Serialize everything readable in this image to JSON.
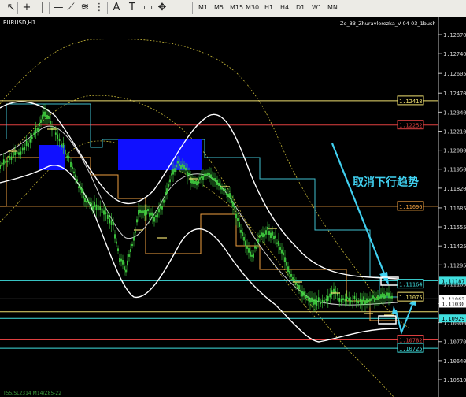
{
  "toolbar": {
    "tools": [
      {
        "icon": "cursor-icon",
        "glyph": "↖"
      },
      {
        "icon": "crosshair-icon",
        "glyph": "+"
      },
      {
        "icon": "vertical-line-icon",
        "glyph": "|"
      },
      {
        "icon": "horizontal-line-icon",
        "glyph": "—"
      },
      {
        "icon": "trendline-icon",
        "glyph": "⟋"
      },
      {
        "icon": "channel-icon",
        "glyph": "≋"
      },
      {
        "icon": "fibonacci-icon",
        "glyph": "⋮"
      },
      {
        "icon": "text-icon",
        "glyph": "A"
      },
      {
        "icon": "label-icon",
        "glyph": "T"
      },
      {
        "icon": "arrow-shapes-icon",
        "glyph": "▭"
      },
      {
        "icon": "more-shapes-icon",
        "glyph": "✥"
      }
    ],
    "timeframes": [
      "M1",
      "M5",
      "M15",
      "M30",
      "H1",
      "H4",
      "D1",
      "W1",
      "MN"
    ]
  },
  "chart": {
    "symbol_label": "EURUSD,H1",
    "indicator_label": "Ze_33_Zhuravlerezka_V-04-03_1bush",
    "annotation_text": "取消下行趋势",
    "bottom_label": "T55/SL2314 M14/Z85-22",
    "price_ticks": [
      "1.12870",
      "1.12740",
      "1.12605",
      "1.12470",
      "1.12340",
      "1.12210",
      "1.12080",
      "1.11950",
      "1.11820",
      "1.11685",
      "1.11555",
      "1.11425",
      "1.11295",
      "1.11165",
      "1.11030",
      "1.10900",
      "1.10770",
      "1.10640",
      "1.10510"
    ],
    "level_labels": [
      {
        "price": "1.12418",
        "color": "#f0e070"
      },
      {
        "price": "1.12252",
        "color": "#e04040"
      },
      {
        "price": "1.11696",
        "color": "#f0a040"
      },
      {
        "price": "1.11164",
        "color": "#40e0e0"
      },
      {
        "price": "1.11075",
        "color": "#f0e070"
      },
      {
        "price": "1.10782",
        "color": "#e04040"
      },
      {
        "price": "1.10725",
        "color": "#40e0e0"
      }
    ],
    "axis_tags": [
      {
        "price": "1.11187",
        "color": "#40e0e0"
      },
      {
        "price": "1.11063",
        "color": "#ffffff"
      },
      {
        "price": "1.11030",
        "color": "#ffffff"
      },
      {
        "price": "1.10929",
        "color": "#40e0e0"
      }
    ],
    "colors": {
      "candles": "#40d040",
      "bands": "#ffffff",
      "resistance": "#40c0d0",
      "support": "#f0a040",
      "arrow": "#40d0f0",
      "blue_box": "#1010ff"
    }
  }
}
